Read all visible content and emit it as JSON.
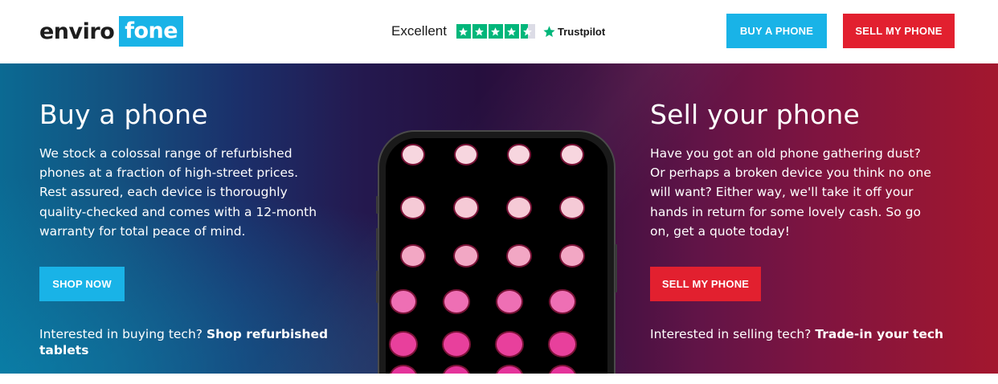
{
  "header": {
    "logo": {
      "left": "enviro",
      "right": "fone"
    },
    "trustpilot": {
      "rating_label": "Excellent",
      "stars": 4.5,
      "brand": "Trustpilot"
    },
    "buttons": {
      "buy": "BUY A PHONE",
      "sell": "SELL MY PHONE"
    }
  },
  "hero": {
    "buy": {
      "title": "Buy a phone",
      "text": "We stock a colossal range of refurbished phones at a fraction of high-street prices. Rest assured, each device is thoroughly quality-checked and comes with a 12-month warranty for total peace of mind.",
      "button": "SHOP NOW",
      "foot_prefix": "Interested in buying tech?",
      "foot_link": "Shop refurbished tablets"
    },
    "sell": {
      "title": "Sell your phone",
      "text": "Have you got an old phone gathering dust? Or perhaps a broken device you think no one will want? Either way, we'll take it off your hands in return for some lovely cash. So go on, get a quote today!",
      "button": "SELL MY PHONE",
      "foot_prefix": "Interested in selling tech?",
      "foot_link": "Trade-in your tech"
    }
  },
  "colors": {
    "accent_blue": "#19b3e7",
    "accent_red": "#e2202f",
    "trustpilot_green": "#00b67a"
  }
}
